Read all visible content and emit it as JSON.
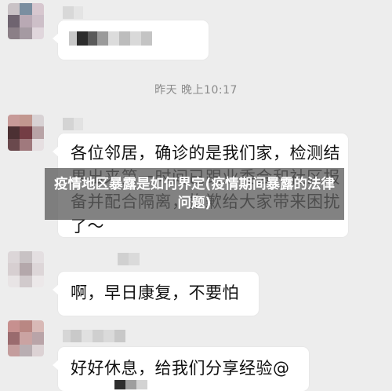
{
  "chat": {
    "messages": [
      {
        "text": ""
      },
      {
        "text": "各位邻居，确诊的是我们家，检测结果出来第一时间已跟业委会和社区报备并配合隔离，抱歉给大家带来困扰了～"
      },
      {
        "text": "啊，早日康复，不要怕"
      },
      {
        "text": "好好休息，给我们分享经验@"
      }
    ],
    "timestamp": "昨天 晚上10:17"
  },
  "article": {
    "title": "疫情地区暴露是如何界定(疫情期间暴露的法律问题)"
  }
}
